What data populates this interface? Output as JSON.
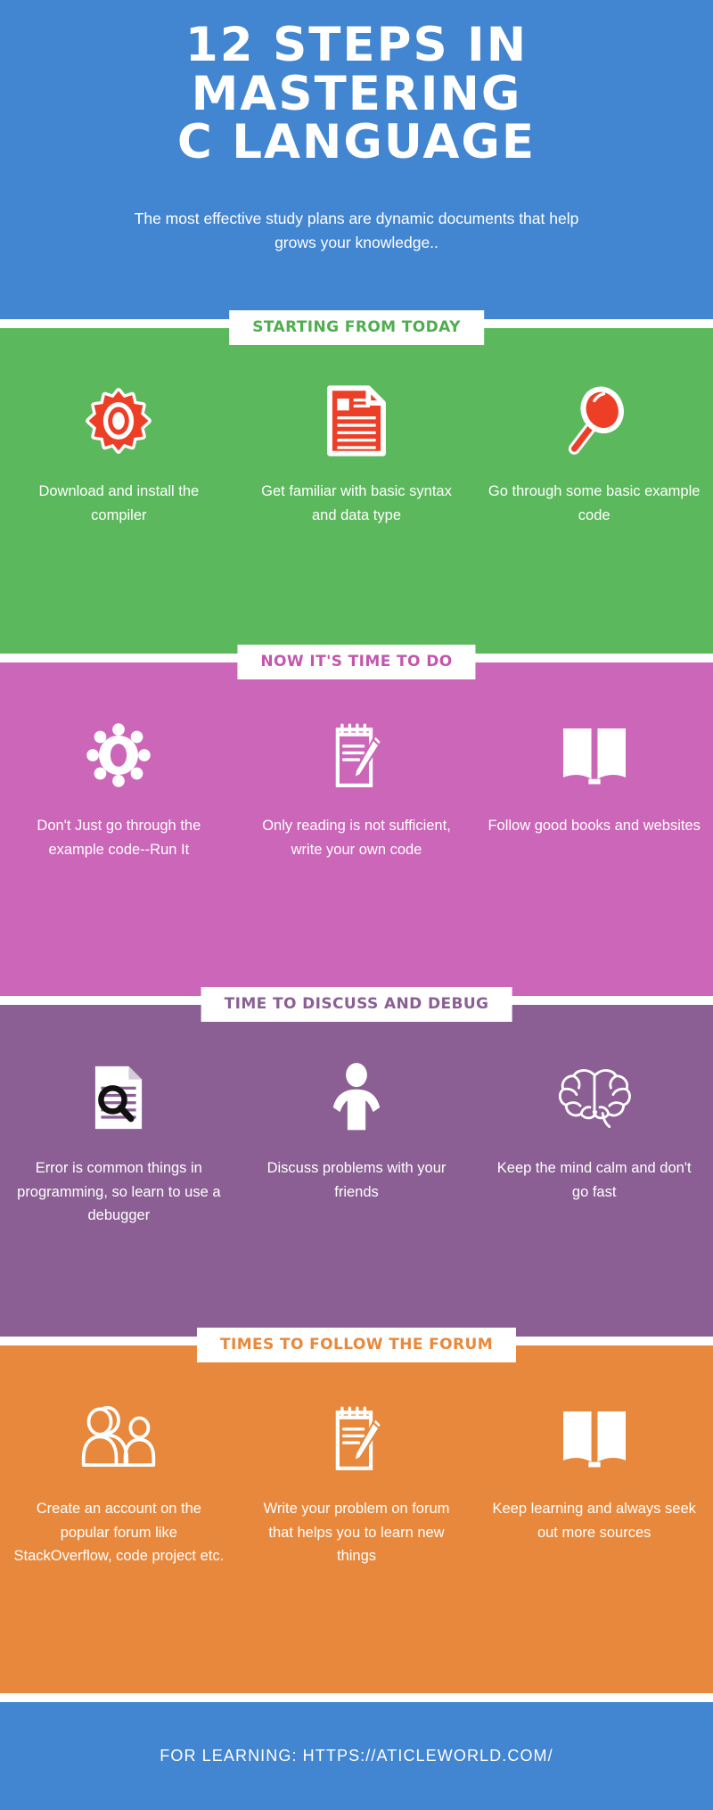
{
  "header": {
    "title_lines": [
      "12 Steps In",
      "Mastering",
      "C Language"
    ],
    "subtitle": "The most effective study plans are dynamic documents that help grows your knowledge.."
  },
  "sections": [
    {
      "banner": "STARTING FROM TODAY",
      "bg_color": "#5cb85c",
      "banner_color": "#4fae4f",
      "icon_style": "red-filled",
      "cards": [
        {
          "icon": "gear-icon",
          "label": "Download and install the compiler"
        },
        {
          "icon": "document-icon",
          "label": "Get familiar with basic syntax and data type"
        },
        {
          "icon": "magnifier-icon",
          "label": "Go through some basic example code"
        }
      ]
    },
    {
      "banner": "NOW IT'S TIME TO DO",
      "bg_color": "#cc66b8",
      "banner_color": "#c456ad",
      "icon_style": "white-filled",
      "cards": [
        {
          "icon": "gear-icon",
          "label": "Don't Just go through the example code--Run It"
        },
        {
          "icon": "notepad-pencil-icon",
          "label": "Only reading is not sufficient, write your own code"
        },
        {
          "icon": "open-book-icon",
          "label": "Follow good books and websites"
        }
      ]
    },
    {
      "banner": "TIME TO DISCUSS AND DEBUG",
      "bg_color": "#8b5f94",
      "banner_color": "#8b5f94",
      "icon_style": "white-filled",
      "cards": [
        {
          "icon": "document-search-icon",
          "label": "Error is common things in programming, so learn to use a debugger"
        },
        {
          "icon": "person-icon",
          "label": "Discuss problems with your friends"
        },
        {
          "icon": "brain-icon",
          "label": "Keep the mind calm and don't go fast"
        }
      ]
    },
    {
      "banner": "TIMES TO FOLLOW THE FORUM",
      "bg_color": "#e8883c",
      "banner_color": "#e8883c",
      "icon_style": "white-outline",
      "cards": [
        {
          "icon": "two-people-icon",
          "label": "Create an account on the popular forum like StackOverflow, code project etc."
        },
        {
          "icon": "notepad-pencil-icon",
          "label": "Write your problem on forum that helps you to learn new things"
        },
        {
          "icon": "open-book-icon",
          "label": "Keep learning and always seek out more sources"
        }
      ]
    }
  ],
  "footer": {
    "text": "FOR LEARNING: HTTPS://ATICLEWORLD.COM/"
  },
  "colors": {
    "header_blue": "#4285d0",
    "green": "#5cb85c",
    "pink": "#cc66b8",
    "purple": "#8b5f94",
    "orange": "#e8883c",
    "icon_red": "#ed3e26",
    "white": "#ffffff"
  }
}
